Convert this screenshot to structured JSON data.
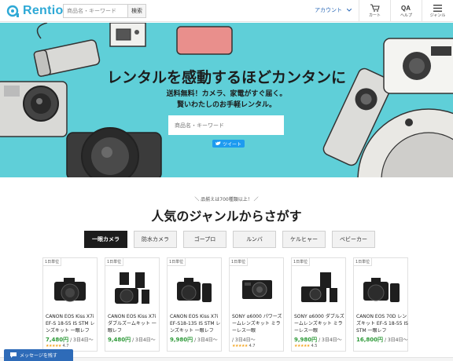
{
  "header": {
    "logo_text": "Rentio",
    "search_placeholder": "商品名・キーワード",
    "search_button": "検索",
    "account_label": "アカウント",
    "icons": [
      {
        "icon": "cart-icon",
        "label": "カート"
      },
      {
        "icon": "help-icon",
        "label": "ヘルプ"
      },
      {
        "icon": "menu-icon",
        "label": "ジャンル"
      }
    ]
  },
  "hero": {
    "title": "レンタルを感動するほどカンタンに",
    "subtitle_line1": "送料無料！カメラ、家電がすぐ届く。",
    "subtitle_line2": "賢いわたしのお手軽レンタル。",
    "search_placeholder": "商品名・キーワード",
    "tweet_label": "ツイート",
    "background_color": "#5fcfd8"
  },
  "genre": {
    "badge": "品揃えは700種類以上！",
    "title": "人気のジャンルからさがす",
    "tabs": [
      "一眼カメラ",
      "防水カメラ",
      "ゴープロ",
      "ルンバ",
      "ケルヒャー",
      "ベビーカー"
    ],
    "active_tab": "一眼カメラ"
  },
  "products": [
    {
      "unit": "1日単位",
      "name": "CANON EOS Kiss X7i EF-S 18-55 IS STM レンズキット 一眼レフ",
      "price": "7,480円",
      "per": "/ 3日4日〜",
      "stars": "★★★★★",
      "rating": "4.7"
    },
    {
      "unit": "1日単位",
      "name": "CANON EOS Kiss X7i ダブルズームキット 一眼レフ",
      "price": "9,480円",
      "per": "/ 3日4日〜",
      "stars": "",
      "rating": ""
    },
    {
      "unit": "1日単位",
      "name": "CANON EOS Kiss X7i EF-S18-135 IS STM レンズキット 一眼レフ",
      "price": "9,980円",
      "per": "/ 3日4日〜",
      "stars": "",
      "rating": ""
    },
    {
      "unit": "1日単位",
      "name": "SONY α6000 パワーズームレンズキット ミラーレス一眼",
      "price": "",
      "per": "/ 3日4日〜",
      "stars": "★★★★★",
      "rating": "4.7"
    },
    {
      "unit": "1日単位",
      "name": "SONY α6000 ダブルズームレンズキット ミラーレス一眼",
      "price": "9,980円",
      "per": "/ 3日4日〜",
      "stars": "★★★★★",
      "rating": "4.5"
    },
    {
      "unit": "1日単位",
      "name": "CANON EOS 70D レンズキット EF-S 18-55 IS STM 一眼レフ",
      "price": "16,800円",
      "per": "/ 3日4日〜",
      "stars": "",
      "rating": ""
    }
  ],
  "message_button": "メッセージを残す"
}
